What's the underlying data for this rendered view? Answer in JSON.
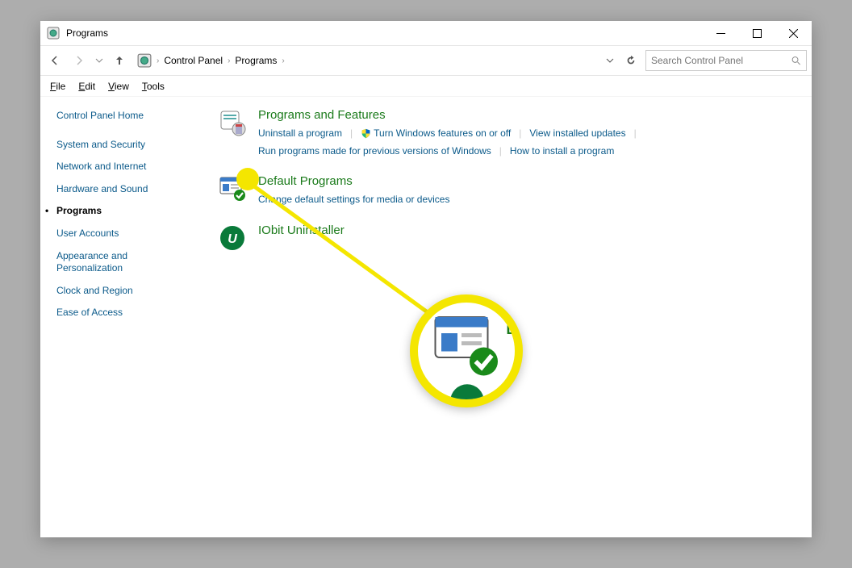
{
  "window": {
    "title": "Programs"
  },
  "breadcrumb": {
    "root_aria": "Control Panel folder",
    "parts": [
      "Control Panel",
      "Programs"
    ]
  },
  "search": {
    "placeholder": "Search Control Panel"
  },
  "menus": {
    "file": "File",
    "edit": "Edit",
    "view": "View",
    "tools": "Tools"
  },
  "sidebar": {
    "items": [
      {
        "label": "Control Panel Home",
        "sel": false
      },
      {
        "label": "System and Security",
        "sel": false
      },
      {
        "label": "Network and Internet",
        "sel": false
      },
      {
        "label": "Hardware and Sound",
        "sel": false
      },
      {
        "label": "Programs",
        "sel": true
      },
      {
        "label": "User Accounts",
        "sel": false
      },
      {
        "label": "Appearance and Personalization",
        "sel": false
      },
      {
        "label": "Clock and Region",
        "sel": false
      },
      {
        "label": "Ease of Access",
        "sel": false
      }
    ]
  },
  "categories": {
    "pf": {
      "title": "Programs and Features",
      "links": {
        "uninstall": "Uninstall a program",
        "winfeat": "Turn Windows features on or off",
        "viewupd": "View installed updates",
        "runprev": "Run programs made for previous versions of Windows",
        "howto": "How to install a program"
      }
    },
    "dp": {
      "title": "Default Programs",
      "links": {
        "change": "Change default settings for media or devices"
      }
    },
    "io": {
      "title": "IObit Uninstaller"
    }
  }
}
